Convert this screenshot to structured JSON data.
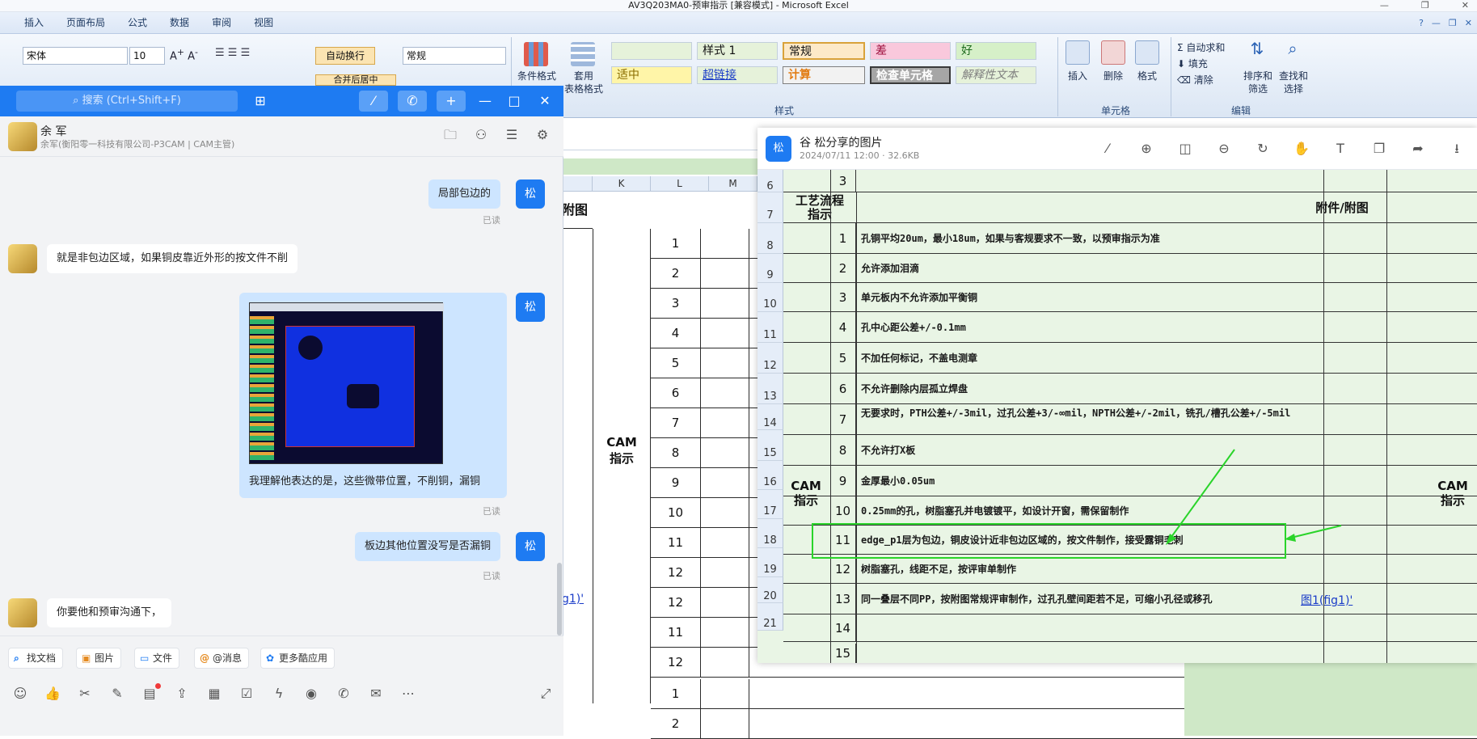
{
  "excel": {
    "title": "AV3Q203MA0-预审指示 [兼容模式] - Microsoft Excel",
    "menu_tabs": [
      "插入",
      "页面布局",
      "公式",
      "数据",
      "审阅",
      "视图"
    ],
    "font_name": "宋体",
    "font_size": "10",
    "wrap_text": "自动换行",
    "merge_center": "合并后居中",
    "number_format": "常规",
    "cond_format": "条件格式",
    "table_format": "套用\n表格格式",
    "styles": {
      "s1": "样式 1",
      "normal": "常规",
      "bad": "差",
      "good": "好",
      "neutral": "适中",
      "hyperlink": "超链接",
      "calc": "计算",
      "check": "检查单元格",
      "explain": "解释性文本"
    },
    "group_styles": "样式",
    "insert": "插入",
    "delete": "删除",
    "format": "格式",
    "group_cells": "单元格",
    "autosum": "自动求和",
    "fill": "填充",
    "clear": "清除",
    "sort_filter": "排序和\n筛选",
    "find_select": "查找和\n选择",
    "group_edit": "编辑",
    "col_headers": [
      "K",
      "L",
      "M"
    ],
    "attach_header": "附图",
    "cam_label": "CAM\n指示",
    "row_numbers": [
      "1",
      "2",
      "3",
      "4",
      "5",
      "6",
      "7",
      "8",
      "9",
      "10",
      "11",
      "12",
      "12",
      "11",
      "12",
      "1",
      "2"
    ],
    "fig_link": "g1)'"
  },
  "chat": {
    "search_placeholder": "搜索 (Ctrl+Shift+F)",
    "contact_name": "余 军",
    "contact_sub": "余军(衡阳零一科技有限公司-P3CAM | CAM主管)",
    "me_avatar": "松",
    "messages": [
      {
        "from": "me",
        "text": "局部包边的",
        "status": "已读"
      },
      {
        "from": "them",
        "text": "就是非包边区域，如果铜皮靠近外形的按文件不削"
      },
      {
        "from": "me",
        "text": "我理解他表达的是，这些微带位置，不削铜，漏铜",
        "status": "已读"
      },
      {
        "from": "me",
        "text": "板边其他位置没写是否漏铜",
        "status": "已读"
      },
      {
        "from": "them",
        "text": "你要他和预审沟通下，"
      }
    ],
    "toolbar_chips": [
      "找文档",
      "图片",
      "文件",
      "@消息",
      "更多酷应用"
    ]
  },
  "viewer": {
    "avatar": "松",
    "title": "谷 松分享的图片",
    "meta": "2024/07/11 12:00 · 32.6KB",
    "left_rownums": [
      "6",
      "7",
      "8",
      "9",
      "10",
      "11",
      "12",
      "13",
      "14",
      "15",
      "16",
      "17",
      "18",
      "19",
      "20",
      "21"
    ],
    "process_header": "工艺流程\n指示",
    "attach_header": "附件/附图",
    "cam_label": "CAM\n指示",
    "top_num": "3",
    "items": [
      {
        "n": "1",
        "t": "孔铜平均20um，最小18um，如果与客规要求不一致，以预审指示为准"
      },
      {
        "n": "2",
        "t": "允许添加泪滴"
      },
      {
        "n": "3",
        "t": "单元板内不允许添加平衡铜"
      },
      {
        "n": "4",
        "t": "孔中心距公差+/-0.1mm"
      },
      {
        "n": "5",
        "t": "不加任何标记，不盖电测章"
      },
      {
        "n": "6",
        "t": "不允许删除内层孤立焊盘"
      },
      {
        "n": "7",
        "t": "无要求时，PTH公差+/-3mil，过孔公差+3/-∞mil，NPTH公差+/-2mil，铣孔/槽孔公差+/-5mil"
      },
      {
        "n": "8",
        "t": "不允许打X板"
      },
      {
        "n": "9",
        "t": "金厚最小0.05um"
      },
      {
        "n": "10",
        "t": "0.25mm的孔，树脂塞孔并电镀镀平，如设计开窗，需保留制作"
      },
      {
        "n": "11",
        "t": "edge_p1层为包边，铜皮设计近非包边区域的，按文件制作，接受露铜毛刺"
      },
      {
        "n": "12",
        "t": "树脂塞孔，线距不足，按评审单制作"
      },
      {
        "n": "13",
        "t": "同一叠层不同PP，按附图常规评审制作，过孔孔壁间距若不足，可缩小孔径或移孔"
      },
      {
        "n": "14",
        "t": ""
      }
    ],
    "fig_link": "图1(fig1)'",
    "bottom_num": "15"
  }
}
